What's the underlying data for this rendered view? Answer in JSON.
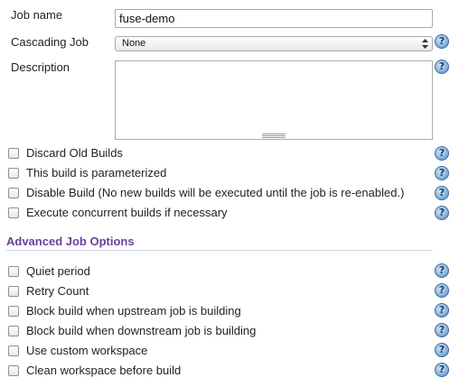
{
  "job_name": {
    "label": "Job name",
    "value": "fuse-demo"
  },
  "cascading_job": {
    "label": "Cascading Job",
    "selected": "None"
  },
  "description": {
    "label": "Description",
    "value": ""
  },
  "help_glyph": "?",
  "general_options": [
    {
      "label": "Discard Old Builds",
      "checked": false
    },
    {
      "label": "This build is parameterized",
      "checked": false
    },
    {
      "label": "Disable Build (No new builds will be executed until the job is re-enabled.)",
      "checked": false
    },
    {
      "label": "Execute concurrent builds if necessary",
      "checked": false
    }
  ],
  "advanced_section": {
    "title": "Advanced Job Options",
    "title_color": "#6a3fa0",
    "options": [
      {
        "label": "Quiet period",
        "checked": false
      },
      {
        "label": "Retry Count",
        "checked": false
      },
      {
        "label": "Block build when upstream job is building",
        "checked": false
      },
      {
        "label": "Block build when downstream job is building",
        "checked": false
      },
      {
        "label": "Use custom workspace",
        "checked": false
      },
      {
        "label": "Clean workspace before build",
        "checked": false
      }
    ]
  },
  "icons": {
    "help": "help-icon",
    "select_arrows": "up-down-arrows-icon",
    "resize": "resize-grip-icon"
  }
}
